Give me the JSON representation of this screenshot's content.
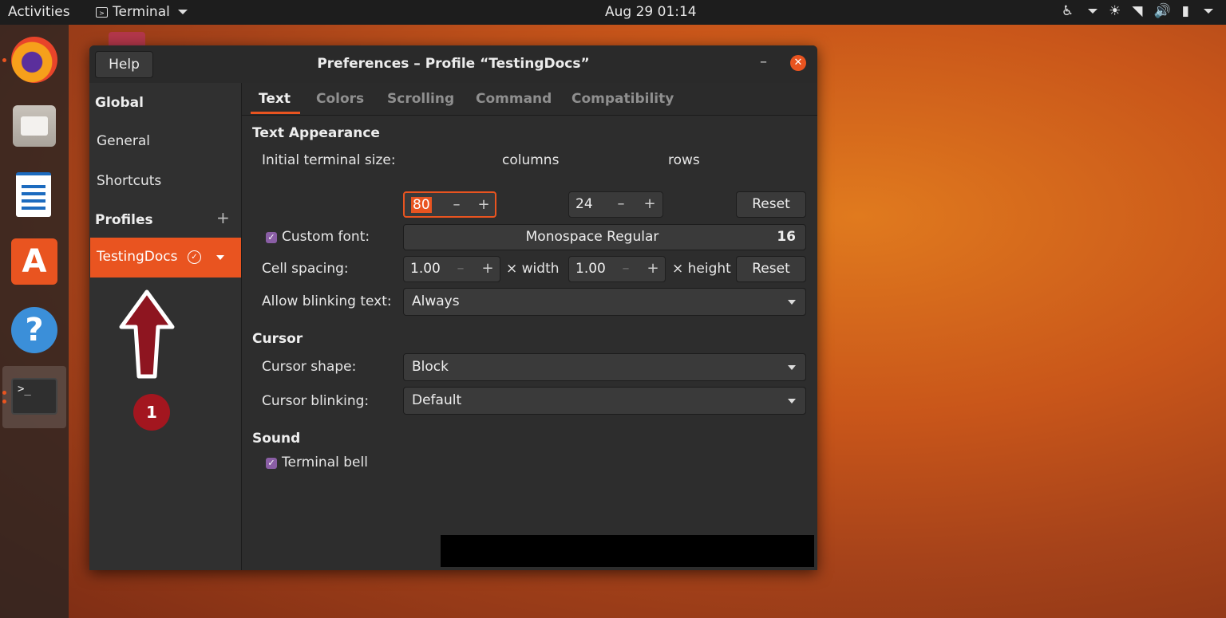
{
  "topbar": {
    "activities": "Activities",
    "app_name": "Terminal",
    "clock": "Aug 29  01:14",
    "tray_icons": [
      "accessibility-icon",
      "sun-icon",
      "wifi-icon",
      "volume-icon",
      "battery-icon"
    ]
  },
  "dock": {
    "items": [
      "firefox-icon",
      "files-icon",
      "writer-icon",
      "software-icon",
      "help-icon",
      "terminal-icon"
    ],
    "terminal_prompt": ">_"
  },
  "window": {
    "help_label": "Help",
    "title": "Preferences – Profile “TestingDocs”",
    "minimize_glyph": "–",
    "close_glyph": "✕"
  },
  "sidebar": {
    "global_heading": "Global",
    "general": "General",
    "shortcuts": "Shortcuts",
    "profiles_heading": "Profiles",
    "add_glyph": "+",
    "profile_name": "TestingDocs",
    "default_glyph": "✓"
  },
  "annotation": {
    "badge_number": "1"
  },
  "tabs": [
    "Text",
    "Colors",
    "Scrolling",
    "Command",
    "Compatibility"
  ],
  "text_tab": {
    "section_appearance": "Text Appearance",
    "initial_size_label": "Initial terminal size:",
    "columns_value": "80",
    "columns_label": "columns",
    "rows_value": "24",
    "rows_label": "rows",
    "reset_label": "Reset",
    "custom_font_label": "Custom font:",
    "font_name": "Monospace Regular",
    "font_size": "16",
    "cell_spacing_label": "Cell spacing:",
    "width_value": "1.00",
    "width_label": "× width",
    "height_value": "1.00",
    "height_label": "× height",
    "blink_text_label": "Allow blinking text:",
    "blink_text_value": "Always",
    "section_cursor": "Cursor",
    "cursor_shape_label": "Cursor shape:",
    "cursor_shape_value": "Block",
    "cursor_blink_label": "Cursor blinking:",
    "cursor_blink_value": "Default",
    "section_sound": "Sound",
    "terminal_bell_label": "Terminal bell",
    "minus_glyph": "–",
    "plus_glyph": "+",
    "check_glyph": "✓"
  },
  "colors": {
    "accent": "#e95420",
    "checkbox": "#8a5ea5",
    "badge": "#a3161f"
  }
}
